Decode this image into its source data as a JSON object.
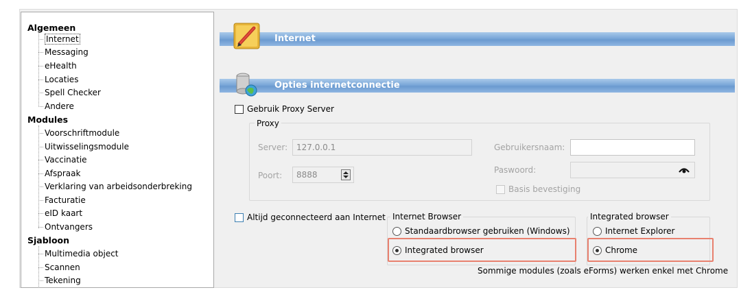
{
  "tree": {
    "categories": [
      {
        "label": "Algemeen",
        "items": [
          "Internet",
          "Messaging",
          "eHealth",
          "Locaties",
          "Spell Checker",
          "Andere"
        ]
      },
      {
        "label": "Modules",
        "items": [
          "Voorschriftmodule",
          "Uitwisselingsmodule",
          "Vaccinatie",
          "Afspraak",
          "Verklaring van arbeidsonderbreking",
          "Facturatie",
          "eID kaart",
          "Ontvangers"
        ]
      },
      {
        "label": "Sjabloon",
        "items": [
          "Multimedia object",
          "Scannen",
          "Tekening"
        ]
      }
    ],
    "selected": "Internet"
  },
  "header": {
    "title": "Internet"
  },
  "options_section": {
    "title": "Opties internetconnectie"
  },
  "proxy": {
    "use_proxy_label": "Gebruik Proxy Server",
    "use_proxy_checked": false,
    "group_title": "Proxy",
    "server_label": "Server:",
    "server_value": "127.0.0.1",
    "port_label": "Poort:",
    "port_value": "8888",
    "username_label": "Gebruikersnaam:",
    "username_value": "",
    "password_label": "Paswoord:",
    "password_value": "",
    "basic_auth_label": "Basis bevestiging",
    "basic_auth_checked": false
  },
  "connection": {
    "always_connected_label": "Altijd geconnecteerd aan Internet",
    "always_connected_checked": false
  },
  "internet_browser": {
    "group_title": "Internet Browser",
    "options": [
      "Standaardbrowser gebruiken (Windows)",
      "Integrated browser"
    ],
    "selected": "Integrated browser"
  },
  "integrated_browser": {
    "group_title": "Integrated browser",
    "options": [
      "Internet Explorer",
      "Chrome"
    ],
    "selected": "Chrome"
  },
  "note": "Sommige modules (zoals eForms) werken enkel met Chrome",
  "colors": {
    "header_bar": "#7aa7d8",
    "highlight_box": "#e8806e"
  }
}
